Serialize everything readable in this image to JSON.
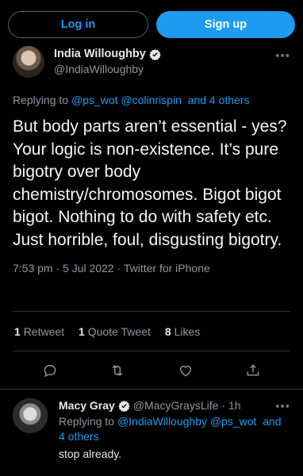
{
  "auth": {
    "login_label": "Log in",
    "signup_label": "Sign up"
  },
  "colors": {
    "accent": "#1d9bf0",
    "background": "#000000",
    "muted": "#8b98a5"
  },
  "tweet": {
    "author_name": "India Willoughby",
    "author_handle": "@IndiaWilloughby",
    "replying_prefix": "Replying to",
    "replying_users": "@ps_wot @colinrispin",
    "replying_others": "and 4 others",
    "text": "But body parts aren’t essential - yes?  Your logic is non-existence. It’s pure bigotry over body chemistry/chromosomes. Bigot bigot bigot. Nothing to do with safety etc. Just horrible, foul, disgusting bigotry.",
    "time": "7:53 pm · 5 Jul 2022 · Twitter for iPhone",
    "stats": {
      "retweets_count": "1",
      "retweets_label": "Retweet",
      "quotes_count": "1",
      "quotes_label": "Quote Tweet",
      "likes_count": "8",
      "likes_label": "Likes"
    },
    "icons": [
      "reply-icon",
      "retweet-icon",
      "like-icon",
      "share-icon"
    ]
  },
  "reply": {
    "author_name": "Macy Gray",
    "author_handle": "@MacyGraysLife",
    "time": "· 1h",
    "replying_prefix": "Replying to",
    "replying_users": "@IndiaWilloughby @ps_wot",
    "replying_others": "and 4 others",
    "text": "stop already."
  }
}
